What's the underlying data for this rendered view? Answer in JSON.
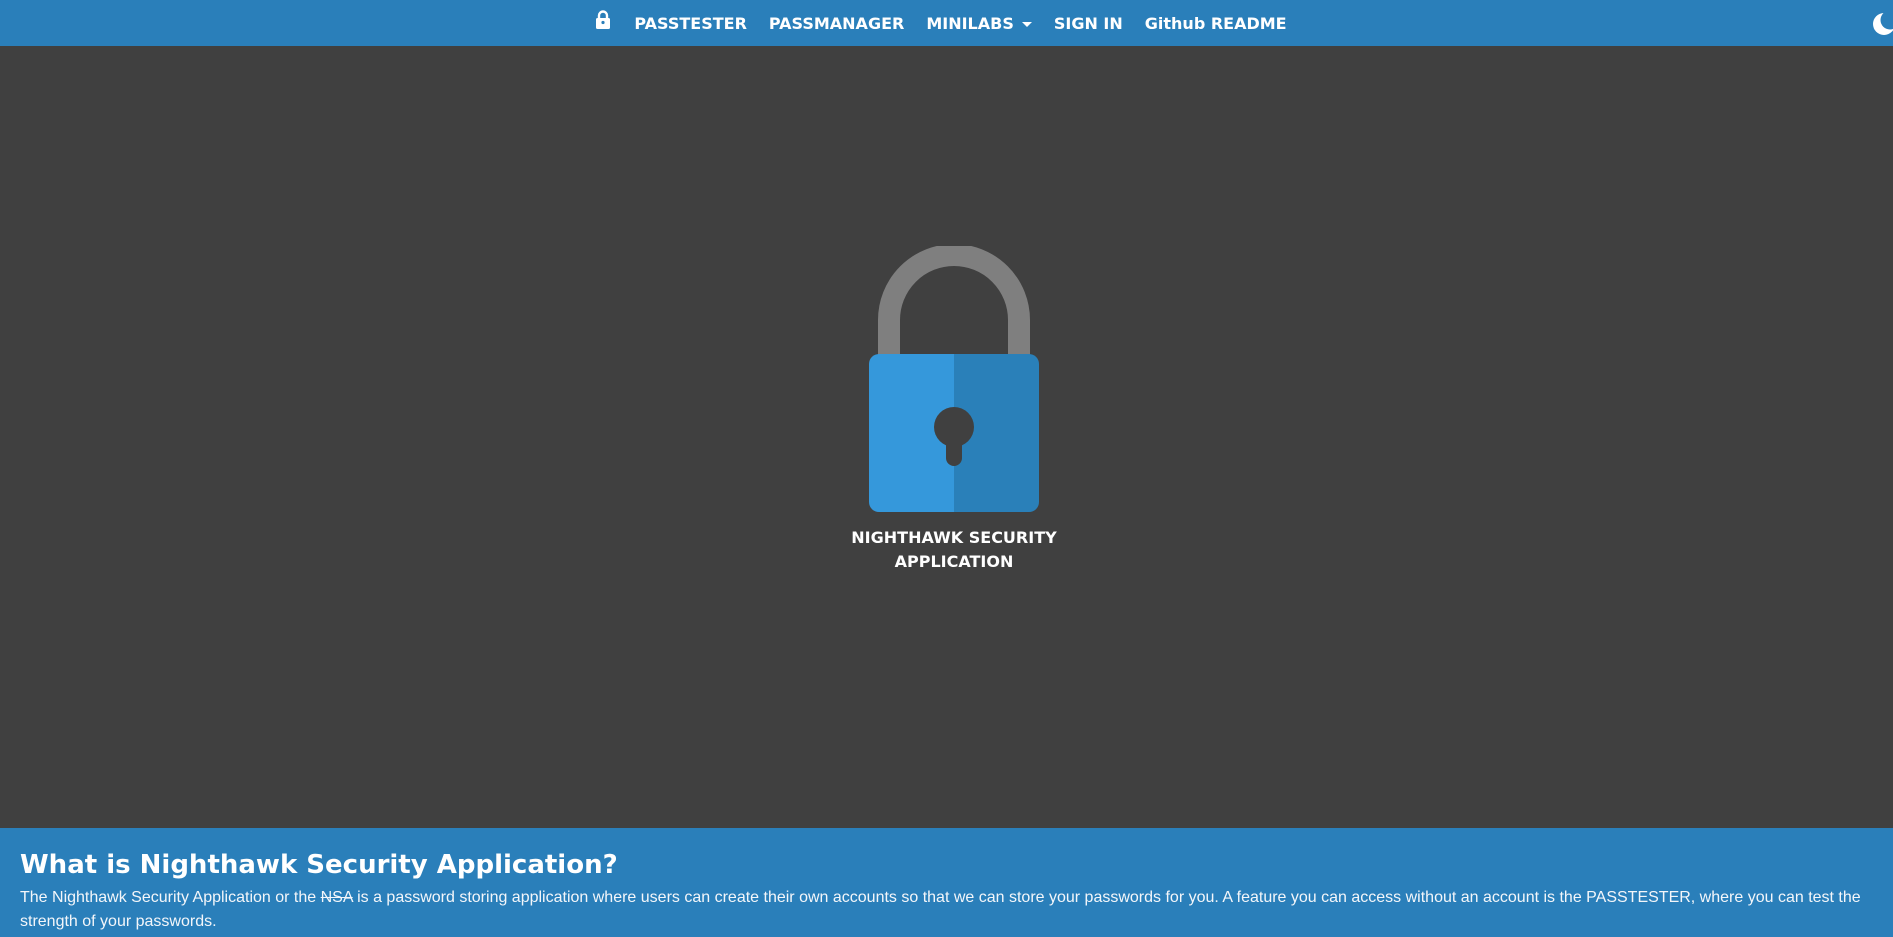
{
  "nav": {
    "items": [
      {
        "label": "PASSTESTER"
      },
      {
        "label": "PASSMANAGER"
      },
      {
        "label": "MINILABS"
      },
      {
        "label": "SIGN IN"
      },
      {
        "label": "Github README"
      }
    ],
    "brand_icon": "lock-icon",
    "theme_icon": "moon-icon"
  },
  "hero": {
    "image_icon": "padlock-icon",
    "title_line1": "NIGHTHAWK SECURITY",
    "title_line2": "APPLICATION"
  },
  "about": {
    "heading": "What is Nighthawk Security Application?",
    "text_before": "The Nighthawk Security Application or the ",
    "text_strike": "NSA",
    "text_after": " is a password storing application where users can create their own accounts so that we can store your passwords for you. A feature you can access without an account is the PASSTESTER, where you can test the strength of your passwords."
  },
  "colors": {
    "navbar": "#2a7fba",
    "background": "#404040",
    "lock_body_light": "#3598db",
    "lock_body_dark": "#2a80b9",
    "lock_shackle": "#7f7f7f"
  }
}
